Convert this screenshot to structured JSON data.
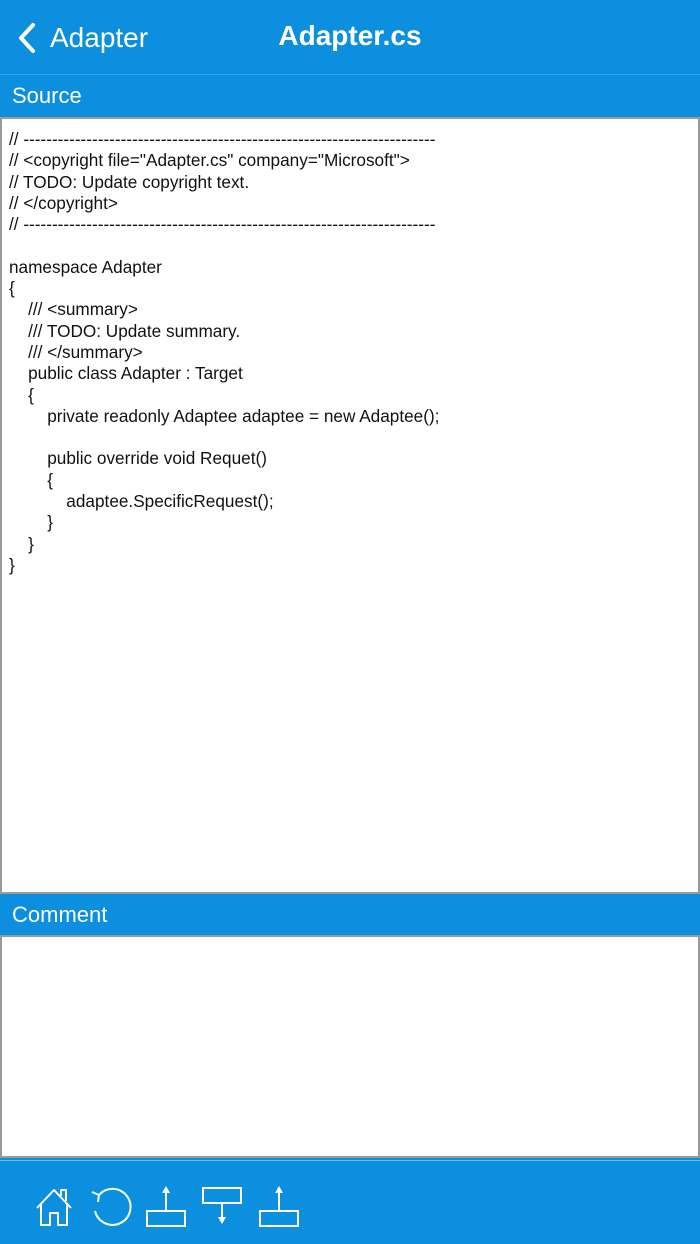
{
  "nav": {
    "back_label": "Adapter",
    "title": "Adapter.cs"
  },
  "source": {
    "header": "Source",
    "code": "// ------------------------------------------------------------------------\n// <copyright file=\"Adapter.cs\" company=\"Microsoft\">\n// TODO: Update copyright text.\n// </copyright>\n// ------------------------------------------------------------------------\n\nnamespace Adapter\n{\n    /// <summary>\n    /// TODO: Update summary.\n    /// </summary>\n    public class Adapter : Target\n    {\n        private readonly Adaptee adaptee = new Adaptee();\n\n        public override void Requet()\n        {\n            adaptee.SpecificRequest();\n        }\n    }\n}"
  },
  "comment": {
    "header": "Comment"
  },
  "toolbar": {
    "items": [
      "home-icon",
      "refresh-icon",
      "move-up-icon",
      "move-down-icon",
      "push-up-icon"
    ]
  },
  "colors": {
    "accent": "#0B8FDE",
    "panel": "#ffffff",
    "border": "#9a9a9a"
  }
}
